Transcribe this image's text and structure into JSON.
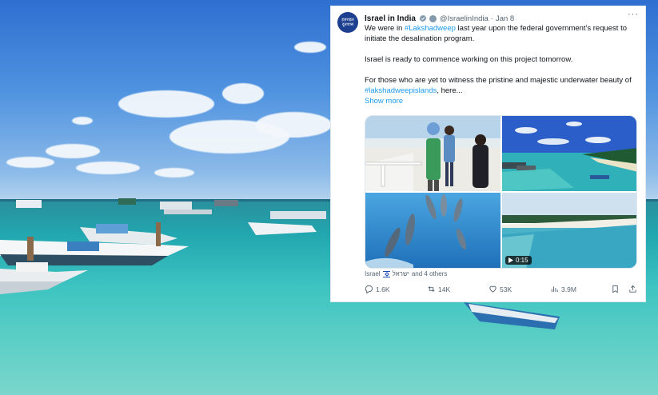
{
  "tweet": {
    "name": "Israel in India",
    "handle": "@IsraelinIndia",
    "separator": "·",
    "date": "Jan 8",
    "more_icon": "more-dots-icon",
    "avatar_text": "इज़राइल दूतावास",
    "text_p1_a": "We were in ",
    "text_p1_hashtag": "#Lakshadweep",
    "text_p1_b": " last year upon the federal government's request to initiate the desalination program.",
    "text_p2": "Israel is ready to commence working on this project tomorrow.",
    "text_p3_a": "For those who are yet to witness the pristine and majestic underwater beauty of ",
    "text_p3_hashtag": "#lakshadweepislands",
    "text_p3_b": ", here...",
    "show_more": "Show more",
    "video_duration": "0:15",
    "tagged_a": "Israel",
    "tagged_b": "ישראל",
    "tagged_c": "and 4 others",
    "actions": {
      "replies": "1.6K",
      "reposts": "14K",
      "likes": "53K",
      "views": "3.9M"
    }
  }
}
